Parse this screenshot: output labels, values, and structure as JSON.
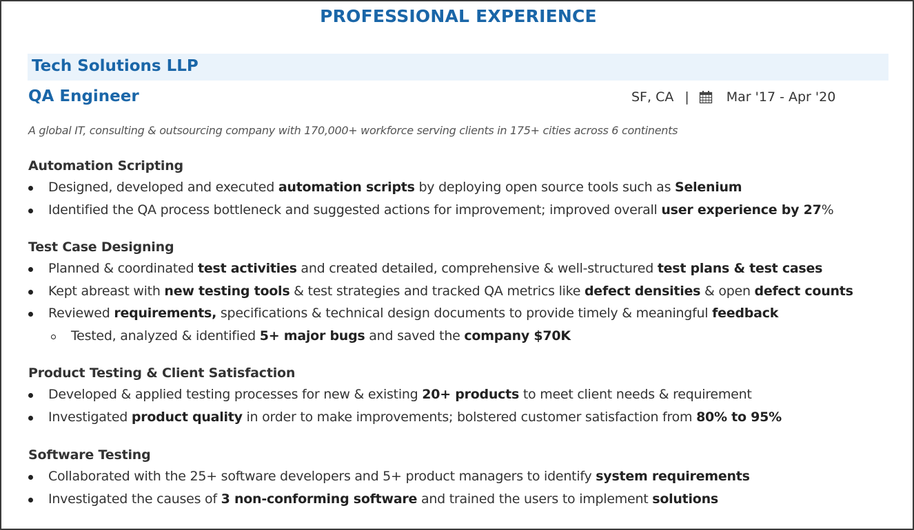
{
  "section_title": "PROFESSIONAL EXPERIENCE",
  "company": "Tech Solutions LLP",
  "role": "QA Engineer",
  "location": "SF, CA",
  "separator": "|",
  "dates": "Mar '17 -  Apr '20",
  "calendar_icon": "calendar-icon",
  "description": "A global IT, consulting & outsourcing company with 170,000+ workforce serving clients in 175+ cities across 6 continents",
  "colors": {
    "accent": "#1a66a8",
    "company_bar_bg": "#eaf3fb",
    "text": "#333333"
  },
  "subsections": [
    {
      "title": "Automation Scripting",
      "bullets": [
        {
          "level": 1,
          "parts": [
            {
              "t": "Designed, developed and executed "
            },
            {
              "t": "automation scripts",
              "b": true
            },
            {
              "t": " by deploying open source tools such as "
            },
            {
              "t": "Selenium",
              "b": true
            }
          ]
        },
        {
          "level": 1,
          "parts": [
            {
              "t": "Identified the QA process bottleneck and suggested actions for improvement; improved overall "
            },
            {
              "t": "user experience by 27",
              "b": true
            },
            {
              "t": "%"
            }
          ]
        }
      ]
    },
    {
      "title": "Test Case Designing",
      "bullets": [
        {
          "level": 1,
          "parts": [
            {
              "t": "Planned & coordinated "
            },
            {
              "t": "test activities",
              "b": true
            },
            {
              "t": " and created detailed, comprehensive & well-structured "
            },
            {
              "t": "test plans & test cases",
              "b": true
            }
          ]
        },
        {
          "level": 1,
          "parts": [
            {
              "t": "Kept abreast with "
            },
            {
              "t": "new testing tools",
              "b": true
            },
            {
              "t": " & test strategies and tracked QA metrics like "
            },
            {
              "t": "defect densities",
              "b": true
            },
            {
              "t": " & open "
            },
            {
              "t": "defect counts",
              "b": true
            }
          ]
        },
        {
          "level": 1,
          "parts": [
            {
              "t": "Reviewed "
            },
            {
              "t": "requirements,",
              "b": true
            },
            {
              "t": " specifications & technical design documents to provide timely & meaningful "
            },
            {
              "t": "feedback",
              "b": true
            }
          ]
        },
        {
          "level": 2,
          "parts": [
            {
              "t": "Tested, analyzed & identified "
            },
            {
              "t": "5+ major bugs",
              "b": true
            },
            {
              "t": " and saved the "
            },
            {
              "t": "company $70K",
              "b": true
            }
          ]
        }
      ]
    },
    {
      "title": "Product Testing & Client Satisfaction",
      "bullets": [
        {
          "level": 1,
          "parts": [
            {
              "t": "Developed & applied testing processes for new & existing "
            },
            {
              "t": "20+ products",
              "b": true
            },
            {
              "t": " to meet client needs & requirement"
            }
          ]
        },
        {
          "level": 1,
          "parts": [
            {
              "t": "Investigated "
            },
            {
              "t": "product quality",
              "b": true
            },
            {
              "t": " in order to make improvements; bolstered customer satisfaction from "
            },
            {
              "t": "80% to 95%",
              "b": true
            }
          ]
        }
      ]
    },
    {
      "title": "Software Testing",
      "bullets": [
        {
          "level": 1,
          "parts": [
            {
              "t": "Collaborated with the 25+ software developers and 5+ product managers to identify "
            },
            {
              "t": "system requirements",
              "b": true
            }
          ]
        },
        {
          "level": 1,
          "parts": [
            {
              "t": "Investigated the causes of "
            },
            {
              "t": "3 non-conforming software",
              "b": true
            },
            {
              "t": " and trained the users to implement "
            },
            {
              "t": "solutions",
              "b": true
            }
          ]
        }
      ]
    }
  ]
}
